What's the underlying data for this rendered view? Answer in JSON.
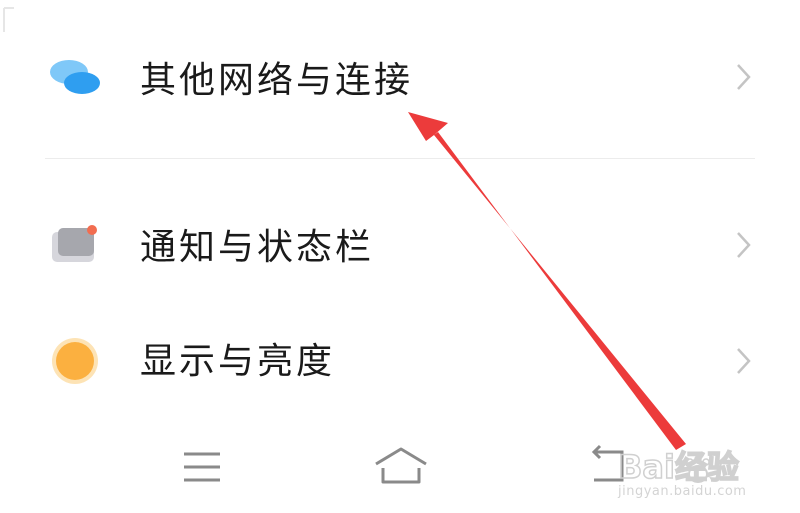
{
  "settings": {
    "items": [
      {
        "label": "其他网络与连接",
        "icon": "chat-bubbles-icon"
      },
      {
        "label": "通知与状态栏",
        "icon": "notification-icon"
      },
      {
        "label": "显示与亮度",
        "icon": "brightness-icon"
      }
    ]
  },
  "navbar": {
    "menu_icon": "menu-icon",
    "home_icon": "home-icon",
    "back_icon": "back-icon"
  },
  "watermark": {
    "brand": "Bai经验",
    "url": "jingyan.baidu.com"
  },
  "colors": {
    "arrow": "#ec3b3b",
    "network_icon": "#3fa9f5",
    "notification_badge": "#f26d50",
    "brightness_icon": "#fbb040"
  }
}
